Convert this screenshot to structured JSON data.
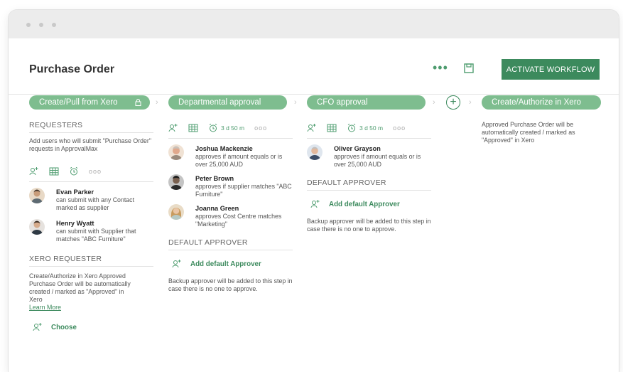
{
  "header": {
    "title": "Purchase Order",
    "more_label": "•••",
    "save_icon": "save-icon",
    "activate_label": "ACTIVATE WORKFLOW"
  },
  "steps": [
    {
      "label": "Create/Pull from Xero",
      "icon": "lock-icon"
    },
    {
      "label": "Departmental approval"
    },
    {
      "label": "CFO approval"
    },
    {
      "label": "Create/Authorize in Xero"
    }
  ],
  "add_step_label": "+",
  "colors": {
    "accent": "#3c8a5d",
    "pill": "#7ebd8f"
  },
  "col1": {
    "requesters_title": "REQUESTERS",
    "requesters_desc": "Add users who will submit \"Purchase Order\" requests in ApprovalMax",
    "ellipsis": "ooo",
    "people": [
      {
        "name": "Evan Parker",
        "desc": "can submit with any Contact marked as supplier"
      },
      {
        "name": "Henry Wyatt",
        "desc": "can submit with Supplier that matches \"ABC Furniture\""
      }
    ],
    "xero_title": "XERO REQUESTER",
    "xero_desc": "Create/Authorize in Xero Approved Purchase Order will be automatically created / marked as \"Approved\" in Xero",
    "learn_more": "Learn More",
    "choose_label": "Choose"
  },
  "col2": {
    "timer": "3 d  50 m",
    "ellipsis": "ooo",
    "people": [
      {
        "name": "Joshua Mackenzie",
        "desc": "approves if amount equals or is over 25,000 AUD"
      },
      {
        "name": "Peter Brown",
        "desc": "approves if supplier matches \"ABC Furniture\""
      },
      {
        "name": "Joanna Green",
        "desc": "approves Cost Centre matches \"Marketing\""
      }
    ],
    "default_title": "DEFAULT APPROVER",
    "add_default": "Add default Approver",
    "backup_desc": "Backup approver will be added to this step in case there is no one to approve."
  },
  "col3": {
    "timer": "3 d  50 m",
    "ellipsis": "ooo",
    "people": [
      {
        "name": "Oliver Grayson",
        "desc": "approves if amount equals or is over 25,000 AUD"
      }
    ],
    "default_title": "DEFAULT APPROVER",
    "add_default": "Add default Approver",
    "backup_desc": "Backup approver will be added to this step in case there is no one to approve."
  },
  "col4": {
    "desc": "Approved Purchase Order will be automatically created / marked as \"Approved\" in Xero"
  }
}
